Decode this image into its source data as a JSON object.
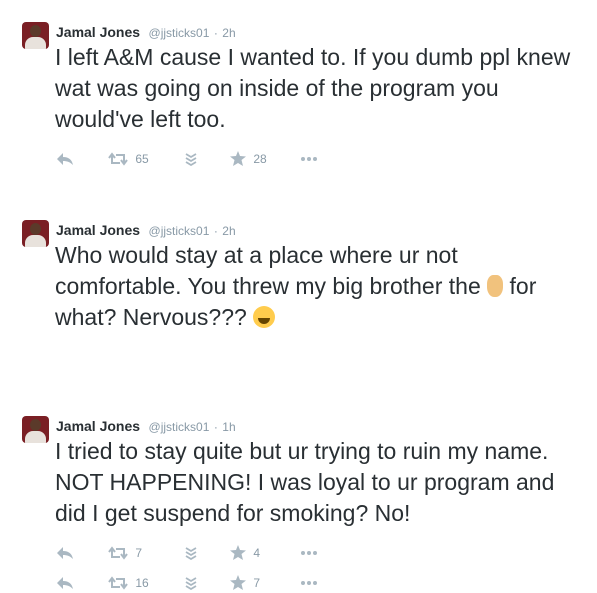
{
  "tweets": [
    {
      "author": "Jamal Jones",
      "handle": "@jjsticks01",
      "separator": "·",
      "time": "2h",
      "text": "I left A&M cause I wanted to. If you dumb ppl knew wat was going on inside of the program you would've left too.",
      "retweets": "65",
      "favorites": "28"
    },
    {
      "author": "Jamal Jones",
      "handle": "@jjsticks01",
      "separator": "·",
      "time": "2h",
      "text_before": "Who would stay at a place where ur not comfortable. You threw my big brother the ",
      "emoji_1": "victory-hand-emoji",
      "text_middle": " for what? Nervous??? ",
      "emoji_2": "tears-of-joy-emoji",
      "retweets": "7",
      "favorites": "4"
    },
    {
      "author": "Jamal Jones",
      "handle": "@jjsticks01",
      "separator": "·",
      "time": "1h",
      "text": "I tried to stay quite but ur trying to ruin my name. NOT HAPPENING! I was loyal to ur program and did I get suspend for smoking? No!",
      "retweets": "16",
      "favorites": "7"
    }
  ],
  "icons": {
    "reply": "reply-icon",
    "retweet": "retweet-icon",
    "stack": "stack-icon",
    "favorite": "star-icon",
    "more": "more-icon"
  },
  "colors": {
    "text": "#292f33",
    "muted": "#8899a6",
    "icon": "#aab8c2"
  }
}
